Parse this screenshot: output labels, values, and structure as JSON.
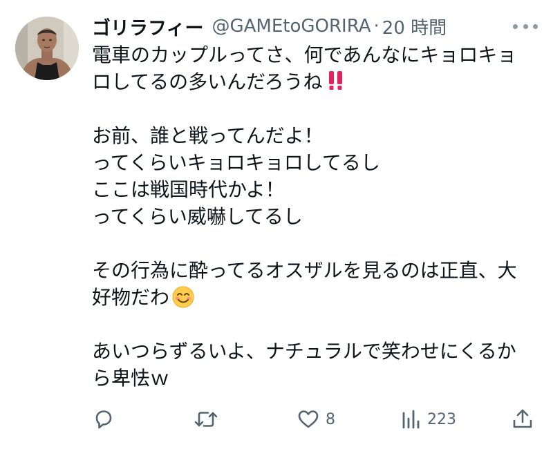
{
  "author": {
    "display_name": "ゴリラフィー",
    "handle": "@GAMEtoGORIRA",
    "separator": "·",
    "time": "20 時間"
  },
  "tweet": {
    "lines": [
      "電車のカップルってさ、何であんなにキョロキョ",
      "ロしてるの多いんだろうね",
      "",
      "お前、誰と戦ってんだよ！",
      "ってくらいキョロキョロしてるし",
      "ここは戦国時代かよ！",
      "ってくらい威嚇してるし",
      "",
      "その行為に酔ってるオスザルを見るのは正直、大",
      "好物だわ",
      "",
      "あいつらずるいよ、ナチュラルで笑わせにくるか",
      "ら卑怯ｗ"
    ],
    "emoji_line_2": "‼️",
    "emoji_line_10": "😊"
  },
  "actions": {
    "reply": {
      "icon": "reply-icon",
      "count": ""
    },
    "retweet": {
      "icon": "retweet-icon",
      "count": ""
    },
    "like": {
      "icon": "heart-icon",
      "count": "8"
    },
    "views": {
      "icon": "views-chart-icon",
      "count": "223"
    },
    "share": {
      "icon": "share-icon",
      "count": ""
    }
  },
  "colors": {
    "text": "#0f1419",
    "secondary": "#536471",
    "emoji_red": "#e0245e",
    "emoji_yellow": "#ffcc4d"
  }
}
